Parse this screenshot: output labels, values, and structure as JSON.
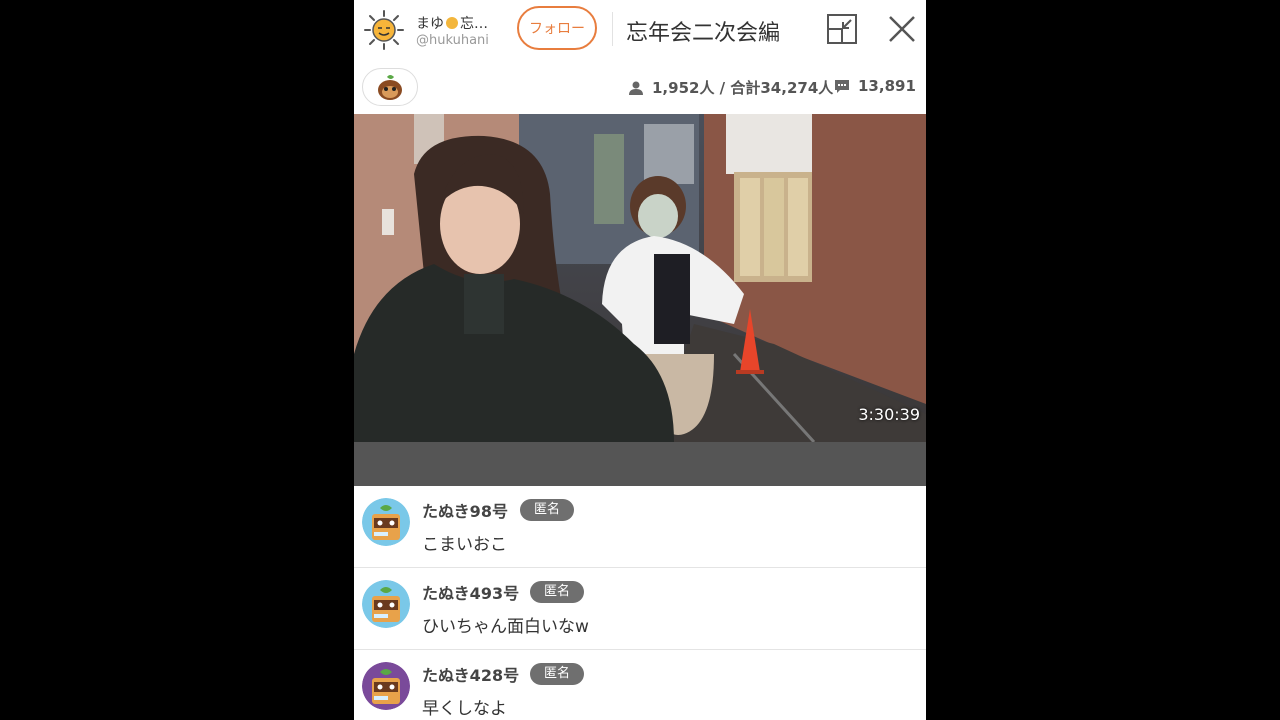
{
  "header": {
    "display_name": "まゆ",
    "display_name_rest": "忘…",
    "handle": "@hukuhani",
    "follow_label": "フォロー",
    "stream_title": "忘年会二次会編"
  },
  "stats": {
    "viewers": "1,952人 / 合計34,274人",
    "comments": "13,891"
  },
  "video": {
    "elapsed": "3:30:39"
  },
  "comments": [
    {
      "name": "たぬき98号",
      "badge": "匿名",
      "text": "こまいおこ",
      "avatar_color": "#7ac8e8"
    },
    {
      "name": "たぬき493号",
      "badge": "匿名",
      "text": "ひいちゃん面白いなw",
      "avatar_color": "#7ac8e8"
    },
    {
      "name": "たぬき428号",
      "badge": "匿名",
      "text": "早くしなよ",
      "avatar_color": "#7a4a9a"
    }
  ],
  "colors": {
    "accent": "#e87d3e",
    "badge_bg": "#6f6f6f"
  }
}
